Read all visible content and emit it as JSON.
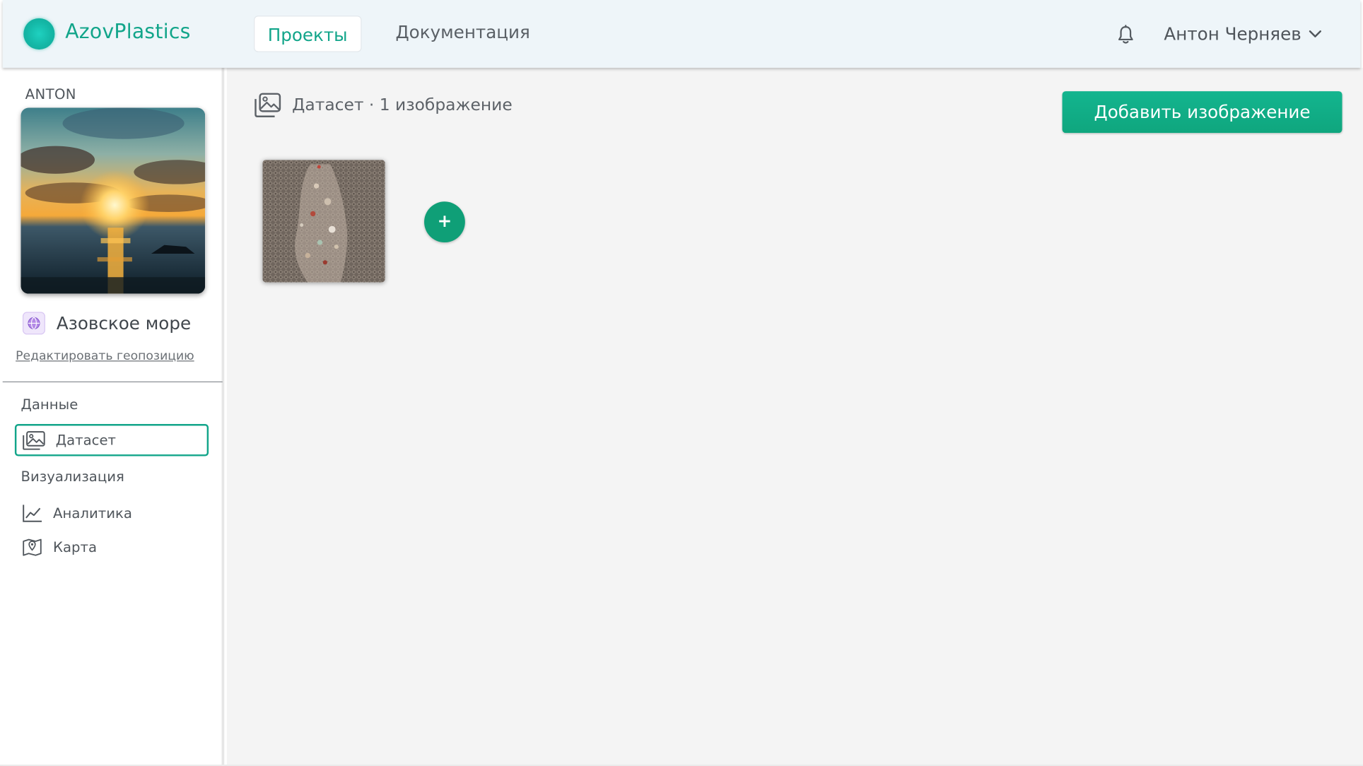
{
  "app": {
    "brand": "AzovPlastics",
    "accent_color": "#12a58a",
    "nav": [
      {
        "label": "Проекты",
        "active": true
      },
      {
        "label": "Документация",
        "active": false
      }
    ],
    "user_name": "Антон Черняев",
    "icons": {
      "notifications": "bell-icon",
      "user_menu": "chevron-down-icon"
    }
  },
  "sidebar": {
    "project_label": "ANTON",
    "project_image": "sunset-over-sea-image",
    "location": {
      "name": "Азовское море",
      "edit_label": "Редактировать геопозицию",
      "icon": "globe-icon"
    },
    "sections": [
      {
        "label": "Данные",
        "items": [
          {
            "label": "Датасет",
            "icon": "image-gallery-icon",
            "active": true
          }
        ]
      },
      {
        "label": "Визуализация",
        "items": [
          {
            "label": "Аналитика",
            "icon": "line-chart-icon",
            "active": false
          },
          {
            "label": "Карта",
            "icon": "map-pin-icon",
            "active": false
          }
        ]
      }
    ]
  },
  "main": {
    "title": "Датасет · 1 изображение",
    "title_icon": "image-gallery-icon",
    "add_button": "Добавить изображение",
    "plus_button": "+",
    "images": [
      {
        "name": "plastic-sample-image"
      }
    ]
  }
}
